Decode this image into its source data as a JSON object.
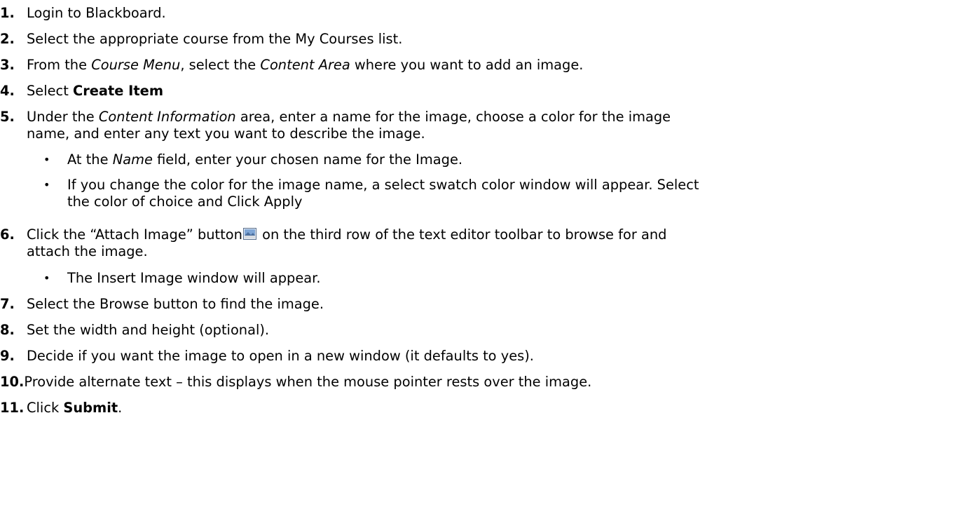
{
  "steps": [
    {
      "num": "1.",
      "text": "Login to Blackboard."
    },
    {
      "num": "2.",
      "text": "Select the appropriate course from the My Courses list."
    },
    {
      "num": "3.",
      "parts": [
        "From the ",
        "Course Menu",
        ", select the ",
        "Content Area",
        " where you want to add an image."
      ]
    },
    {
      "num": "4.",
      "parts": [
        "Select ",
        "Create Item"
      ]
    },
    {
      "num": "5.",
      "parts": [
        "Under the ",
        "Content Information",
        " area, enter a name for the image, choose a color for the image"
      ],
      "cont": "name, and enter any text you want to describe the image."
    },
    {
      "num": "6.",
      "parts": [
        "Click the “Attach Image” button",
        " on the third row of the text editor toolbar to browse for and"
      ],
      "cont": "attach the image."
    },
    {
      "num": "7.",
      "text": "Select the Browse button to find the image."
    },
    {
      "num": "8.",
      "text": "Set the width and height (optional)."
    },
    {
      "num": "9.",
      "text": "Decide if you want the image to open in a new window (it defaults to yes)."
    },
    {
      "num": "10.",
      "text": "Provide alternate text – this displays when the mouse pointer rests over the image."
    },
    {
      "num": "11.",
      "parts": [
        "Click ",
        "Submit",
        "."
      ]
    }
  ],
  "bullets": [
    {
      "parts": [
        "At the ",
        "Name",
        " field, enter your chosen name for the Image."
      ]
    },
    {
      "text": "If you change the color for the image name, a select swatch color window will appear. Select",
      "cont": "the color of choice and Click Apply"
    },
    {
      "text": "The Insert Image window will appear."
    }
  ],
  "bullet_char": "•",
  "icons": {
    "attach_image": "image-icon"
  }
}
